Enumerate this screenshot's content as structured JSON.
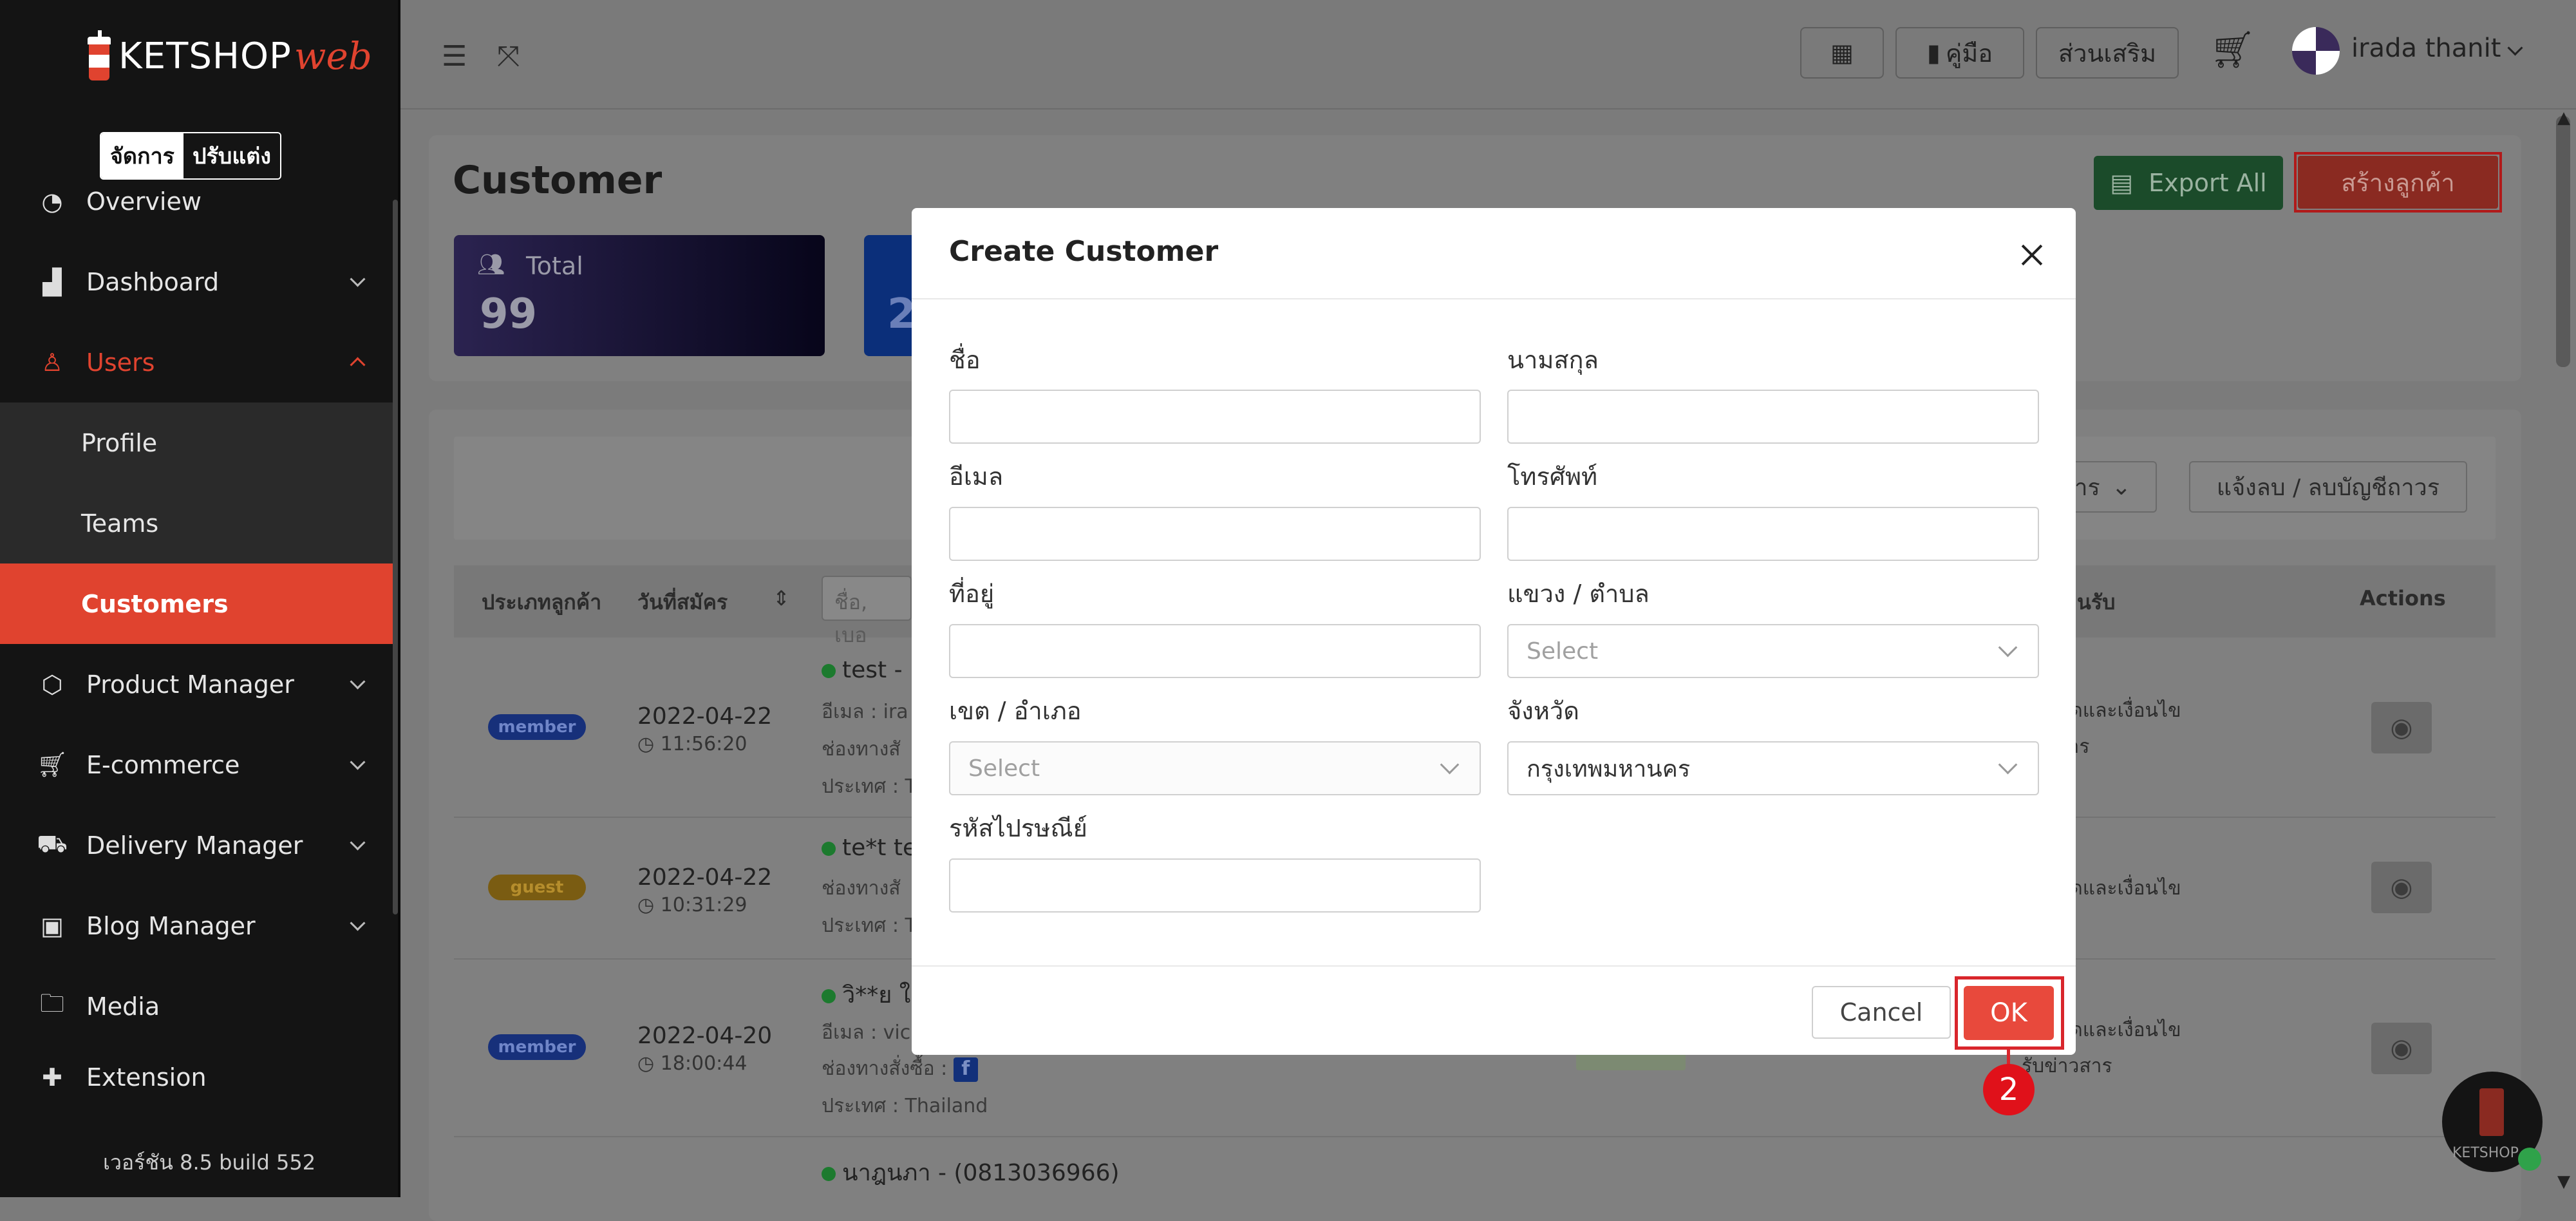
{
  "sidebar": {
    "brand": {
      "word": "KETSHOP",
      "accent": "web"
    },
    "mode": {
      "manage": "จัดการ",
      "customize": "ปรับแต่ง"
    },
    "items": [
      {
        "label": "Overview",
        "icon": "pie-chart-icon"
      },
      {
        "label": "Dashboard",
        "icon": "bar-chart-icon"
      },
      {
        "label": "Users",
        "icon": "user-icon"
      },
      {
        "label": "Product Manager",
        "icon": "box-icon"
      },
      {
        "label": "E-commerce",
        "icon": "cart-icon"
      },
      {
        "label": "Delivery Manager",
        "icon": "truck-icon"
      },
      {
        "label": "Blog Manager",
        "icon": "blog-icon"
      },
      {
        "label": "Media",
        "icon": "folder-icon"
      },
      {
        "label": "Extension",
        "icon": "puzzle-icon"
      }
    ],
    "users_sub": [
      "Profile",
      "Teams",
      "Customers"
    ],
    "version": "เวอร์ชัน 8.5 build 552"
  },
  "topbar": {
    "manual": "คู่มือ",
    "addons": "ส่วนเสริม",
    "user": "irada thanit"
  },
  "page": {
    "title": "Customer",
    "stats": [
      {
        "label": "Total",
        "value": "99"
      },
      {
        "value": "2"
      }
    ],
    "export_all": "Export All",
    "create_customer": "สร้างลูกค้า",
    "filter_news": "วสาร",
    "delete_notice": "แจ้งลบ / ลบบัญชีถาวร",
    "search_placeholder": "ชื่อ, เบอ",
    "columns": {
      "type": "ประเภทลูกค้า",
      "signup": "วันที่สมัคร",
      "receive": "นรับ",
      "actions": "Actions"
    },
    "rows": [
      {
        "badge": "member",
        "date": "2022-04-22",
        "time": "11:56:20",
        "name": "test -",
        "sub1": "อีเมล : ira",
        "sub2": "ช่องทางสั",
        "sub3": "ประเทศ : T",
        "right1": "กำหนดและเงื่อนไข",
        "right2": "ข่าวสาร"
      },
      {
        "badge": "guest",
        "date": "2022-04-22",
        "time": "10:31:29",
        "name": "te*t te",
        "sub1": "ช่องทางสั",
        "sub2": "ประเทศ : T",
        "right1": "กำหนดและเงื่อนไข"
      },
      {
        "badge": "member",
        "date": "2022-04-20",
        "time": "18:00:44",
        "name": "วิ**ย ใ",
        "sub1": "อีเมล : vic",
        "sub2": "ช่องทางสั่งซื้อ :",
        "sub3": "ประเทศ : Thailand",
        "right1": "กำหนดและเงื่อนไข",
        "right2": "รับข่าวสาร"
      },
      {
        "name": "นาฎนภา - (0813036966)"
      }
    ]
  },
  "modal": {
    "title": "Create Customer",
    "fields": {
      "first_name": {
        "label": "ชื่อ",
        "value": ""
      },
      "last_name": {
        "label": "นามสกุล",
        "value": ""
      },
      "email": {
        "label": "อีเมล",
        "value": ""
      },
      "phone": {
        "label": "โทรศัพท์",
        "value": ""
      },
      "address": {
        "label": "ที่อยู่",
        "value": ""
      },
      "subdistrict": {
        "label": "แขวง / ตำบล",
        "placeholder": "Select"
      },
      "district": {
        "label": "เขต / อำเภอ",
        "placeholder": "Select"
      },
      "province": {
        "label": "จังหวัด",
        "value": "กรุงเทพมหานคร"
      },
      "postcode": {
        "label": "รหัสไปรษณีย์",
        "value": ""
      }
    },
    "cancel": "Cancel",
    "ok": "OK",
    "step_marker": "2"
  },
  "chatbot": {
    "caption": "KETSHOP"
  },
  "colors": {
    "brand_red": "#e0432f",
    "highlight": "#d9262c",
    "sidebar_bg": "#141414",
    "overlay_bg": "#7b7b7b"
  }
}
